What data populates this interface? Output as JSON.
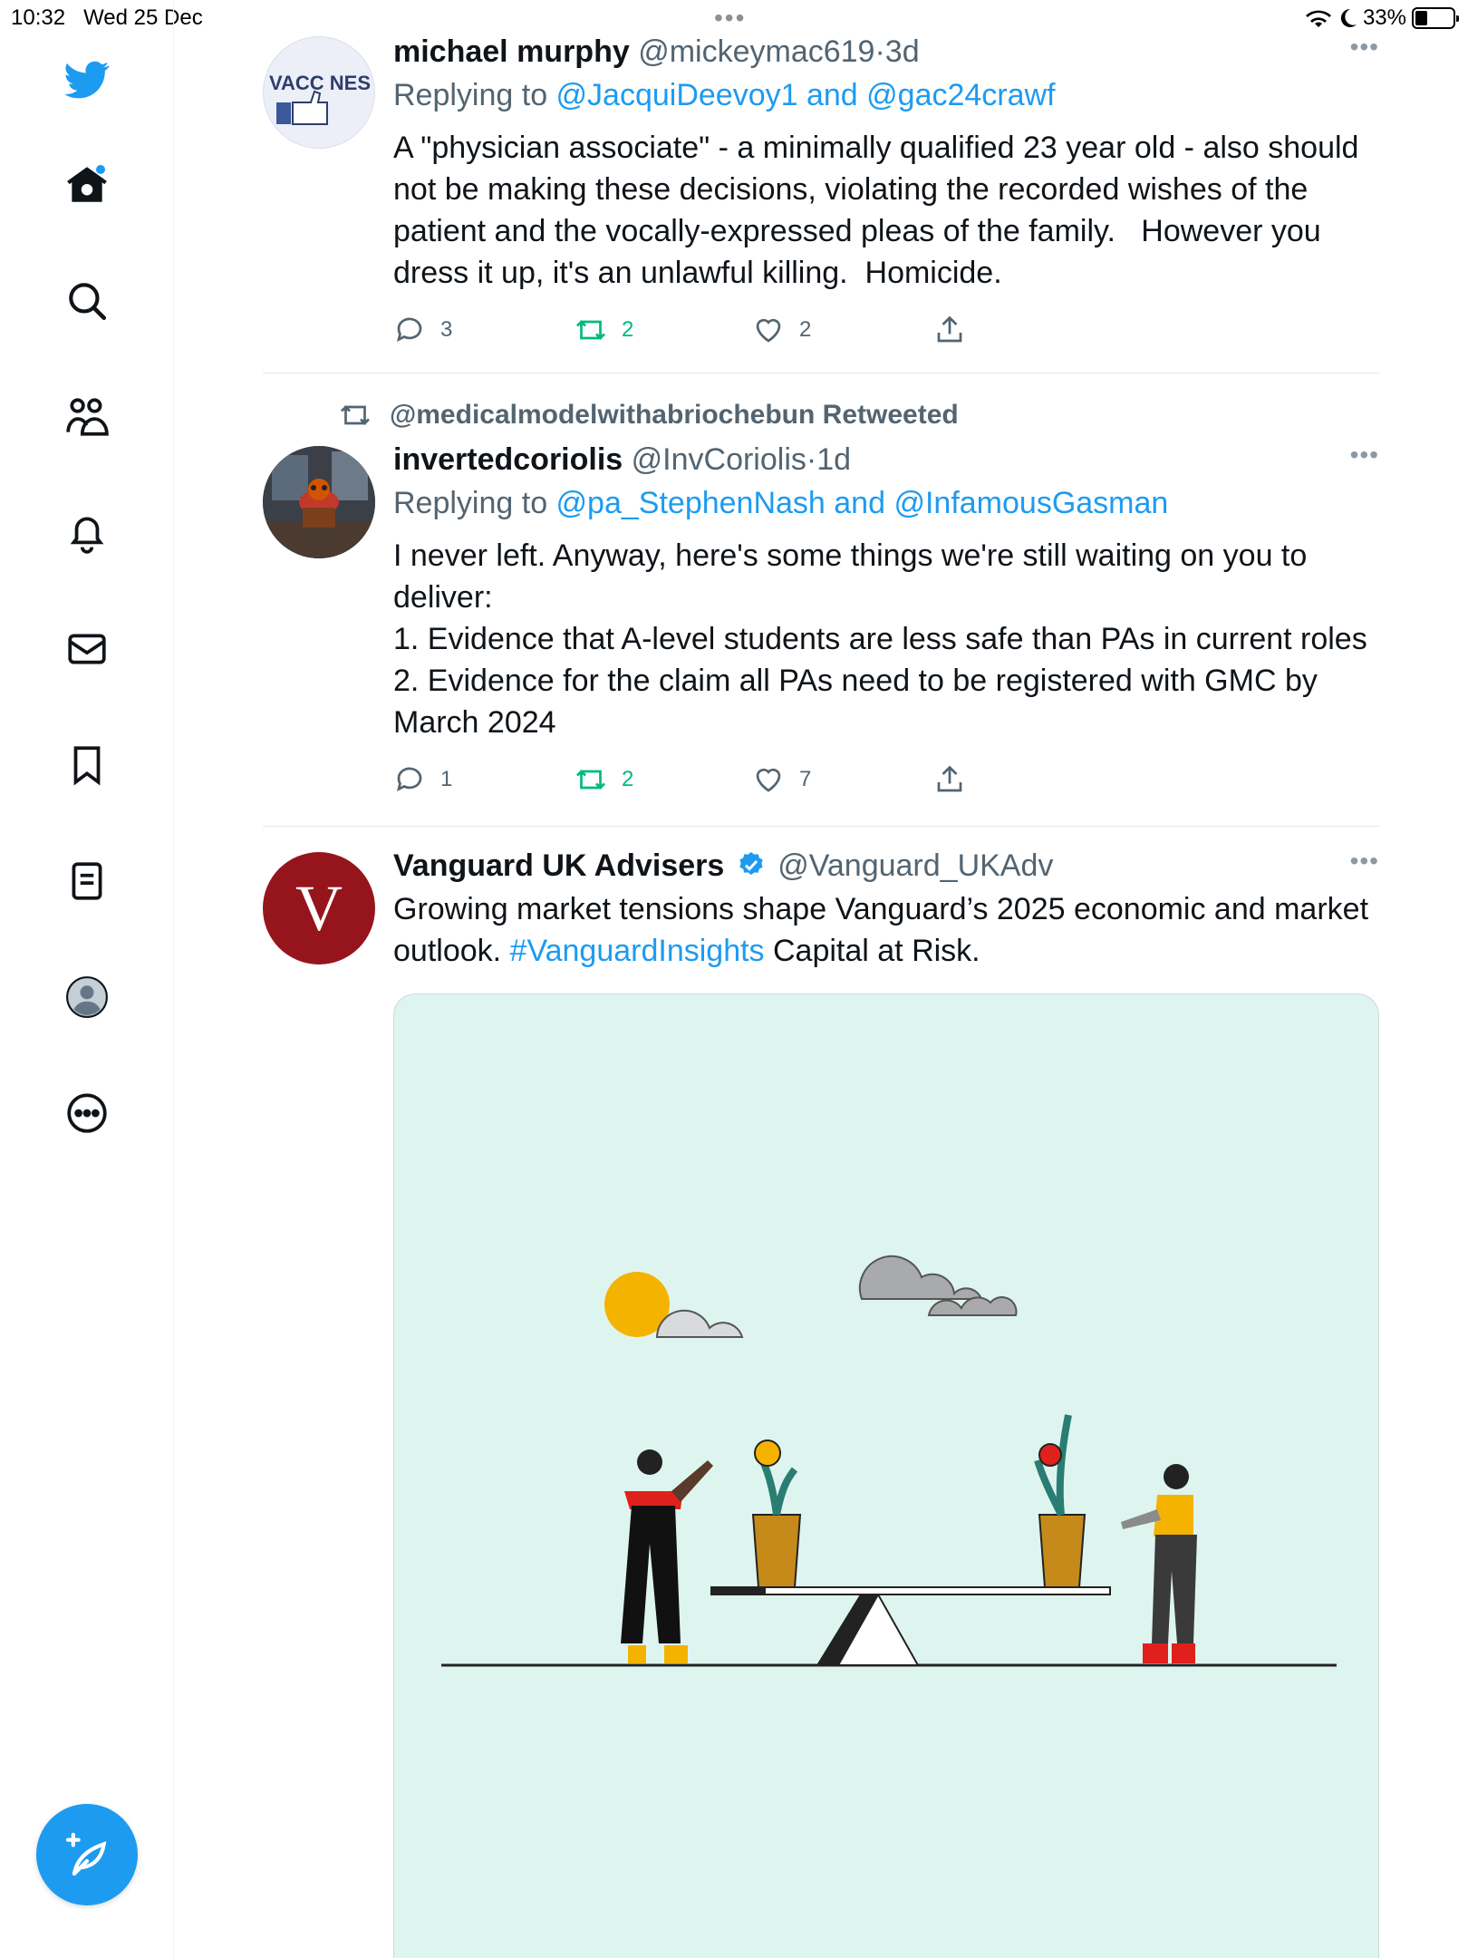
{
  "status_bar": {
    "time": "10:32",
    "date": "Wed 25 Dec",
    "dots": "•••",
    "battery_text": "33%",
    "battery_level": 0.33,
    "icons": [
      "wifi-icon",
      "moon-icon",
      "battery-icon"
    ]
  },
  "sidebar": {
    "items": [
      {
        "name": "twitter-logo",
        "icon": "bird"
      },
      {
        "name": "home",
        "icon": "home",
        "has_notification": true
      },
      {
        "name": "explore",
        "icon": "search"
      },
      {
        "name": "communities",
        "icon": "people"
      },
      {
        "name": "notifications",
        "icon": "bell"
      },
      {
        "name": "messages",
        "icon": "mail"
      },
      {
        "name": "bookmarks",
        "icon": "bookmark"
      },
      {
        "name": "lists",
        "icon": "list"
      },
      {
        "name": "profile",
        "icon": "avatar"
      },
      {
        "name": "more",
        "icon": "more-circle"
      }
    ],
    "compose_icon": "compose-feather"
  },
  "tweets": [
    {
      "avatar_text": "VACC NES",
      "name": "michael murphy",
      "handle": "@mickeymac619",
      "separator": "·",
      "time": "3d",
      "more": "•••",
      "reply_prefix": "Replying to ",
      "reply_to": "@JacquiDeevoy1 and @gac24crawf",
      "text_lines": [
        "A \"physician associate\" - a minimally qualified 23 year old - also should",
        "not be making these decisions, violating the recorded wishes of the",
        "patient and the vocally-expressed pleas of the family.   However you",
        "dress it up, it's an unlawful killing.  Homicide."
      ],
      "replies": "3",
      "retweets": "2",
      "likes": "2"
    },
    {
      "retweeted_by": "@medicalmodelwithabriochebun Retweeted",
      "name": "invertedcoriolis",
      "handle": "@InvCoriolis",
      "separator": "·",
      "time": "1d",
      "more": "•••",
      "reply_prefix": "Replying to ",
      "reply_to": "@pa_StephenNash and @InfamousGasman",
      "text_lines": [
        "I never left. Anyway, here's some things we're still waiting on you to",
        "deliver:",
        "1. Evidence that A-level students are less safe than PAs in current roles",
        "2. Evidence for the claim all PAs need to be registered with GMC by",
        "March 2024"
      ],
      "replies": "1",
      "retweets": "2",
      "likes": "7"
    },
    {
      "avatar_letter": "V",
      "name": "Vanguard UK Advisers",
      "handle": "@Vanguard_UKAdv",
      "more": "•••",
      "text_line1": "Growing market tensions shape Vanguard’s 2025 economic and market",
      "text_line2_pre": "outlook. ",
      "hashtag": "#VanguardInsights",
      "text_line2_post": " Capital at Risk."
    }
  ],
  "colors": {
    "accent": "#1d9bf0",
    "retweet_green": "#00ba7c",
    "secondary_text": "#536471",
    "media_bg": "#def5ef",
    "vanguard_red": "#96151d"
  }
}
